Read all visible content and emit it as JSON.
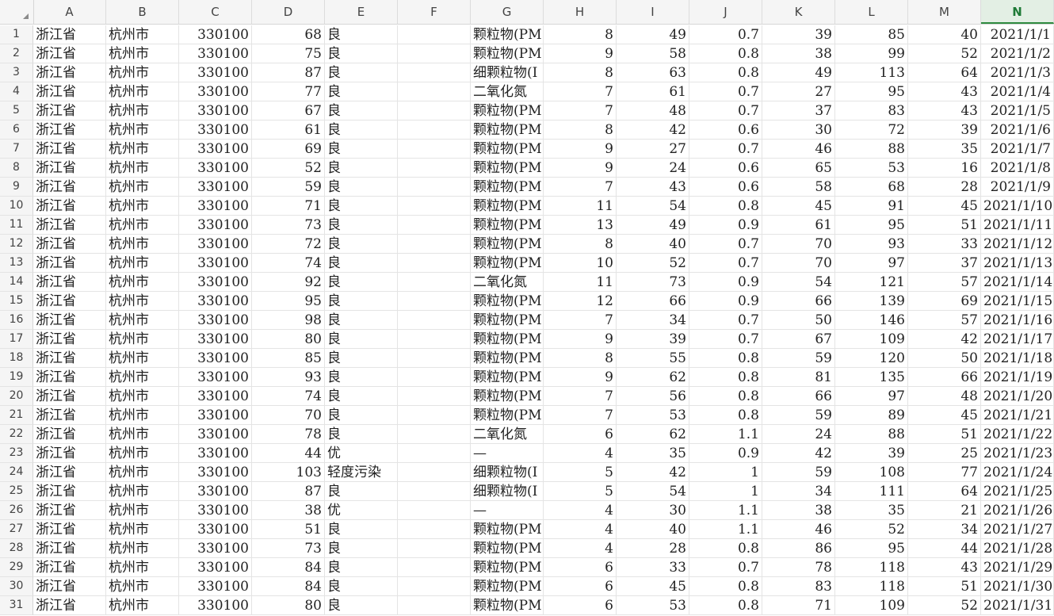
{
  "columns": [
    "A",
    "B",
    "C",
    "D",
    "E",
    "F",
    "G",
    "H",
    "I",
    "J",
    "K",
    "L",
    "M",
    "N"
  ],
  "active_column": "N",
  "rows": [
    [
      "1",
      "浙江省",
      "杭州市",
      "330100",
      "68",
      "良",
      "",
      "颗粒物(PM",
      "8",
      "49",
      "0.7",
      "39",
      "85",
      "40",
      "2021/1/1"
    ],
    [
      "2",
      "浙江省",
      "杭州市",
      "330100",
      "75",
      "良",
      "",
      "颗粒物(PM",
      "9",
      "58",
      "0.8",
      "38",
      "99",
      "52",
      "2021/1/2"
    ],
    [
      "3",
      "浙江省",
      "杭州市",
      "330100",
      "87",
      "良",
      "",
      "细颗粒物(I",
      "8",
      "63",
      "0.8",
      "49",
      "113",
      "64",
      "2021/1/3"
    ],
    [
      "4",
      "浙江省",
      "杭州市",
      "330100",
      "77",
      "良",
      "",
      "二氧化氮",
      "7",
      "61",
      "0.7",
      "27",
      "95",
      "43",
      "2021/1/4"
    ],
    [
      "5",
      "浙江省",
      "杭州市",
      "330100",
      "67",
      "良",
      "",
      "颗粒物(PM",
      "7",
      "48",
      "0.7",
      "37",
      "83",
      "43",
      "2021/1/5"
    ],
    [
      "6",
      "浙江省",
      "杭州市",
      "330100",
      "61",
      "良",
      "",
      "颗粒物(PM",
      "8",
      "42",
      "0.6",
      "30",
      "72",
      "39",
      "2021/1/6"
    ],
    [
      "7",
      "浙江省",
      "杭州市",
      "330100",
      "69",
      "良",
      "",
      "颗粒物(PM",
      "9",
      "27",
      "0.7",
      "46",
      "88",
      "35",
      "2021/1/7"
    ],
    [
      "8",
      "浙江省",
      "杭州市",
      "330100",
      "52",
      "良",
      "",
      "颗粒物(PM",
      "9",
      "24",
      "0.6",
      "65",
      "53",
      "16",
      "2021/1/8"
    ],
    [
      "9",
      "浙江省",
      "杭州市",
      "330100",
      "59",
      "良",
      "",
      "颗粒物(PM",
      "7",
      "43",
      "0.6",
      "58",
      "68",
      "28",
      "2021/1/9"
    ],
    [
      "10",
      "浙江省",
      "杭州市",
      "330100",
      "71",
      "良",
      "",
      "颗粒物(PM",
      "11",
      "54",
      "0.8",
      "45",
      "91",
      "45",
      "2021/1/10"
    ],
    [
      "11",
      "浙江省",
      "杭州市",
      "330100",
      "73",
      "良",
      "",
      "颗粒物(PM",
      "13",
      "49",
      "0.9",
      "61",
      "95",
      "51",
      "2021/1/11"
    ],
    [
      "12",
      "浙江省",
      "杭州市",
      "330100",
      "72",
      "良",
      "",
      "颗粒物(PM",
      "8",
      "40",
      "0.7",
      "70",
      "93",
      "33",
      "2021/1/12"
    ],
    [
      "13",
      "浙江省",
      "杭州市",
      "330100",
      "74",
      "良",
      "",
      "颗粒物(PM",
      "10",
      "52",
      "0.7",
      "70",
      "97",
      "37",
      "2021/1/13"
    ],
    [
      "14",
      "浙江省",
      "杭州市",
      "330100",
      "92",
      "良",
      "",
      "二氧化氮",
      "11",
      "73",
      "0.9",
      "54",
      "121",
      "57",
      "2021/1/14"
    ],
    [
      "15",
      "浙江省",
      "杭州市",
      "330100",
      "95",
      "良",
      "",
      "颗粒物(PM",
      "12",
      "66",
      "0.9",
      "66",
      "139",
      "69",
      "2021/1/15"
    ],
    [
      "16",
      "浙江省",
      "杭州市",
      "330100",
      "98",
      "良",
      "",
      "颗粒物(PM",
      "7",
      "34",
      "0.7",
      "50",
      "146",
      "57",
      "2021/1/16"
    ],
    [
      "17",
      "浙江省",
      "杭州市",
      "330100",
      "80",
      "良",
      "",
      "颗粒物(PM",
      "9",
      "39",
      "0.7",
      "67",
      "109",
      "42",
      "2021/1/17"
    ],
    [
      "18",
      "浙江省",
      "杭州市",
      "330100",
      "85",
      "良",
      "",
      "颗粒物(PM",
      "8",
      "55",
      "0.8",
      "59",
      "120",
      "50",
      "2021/1/18"
    ],
    [
      "19",
      "浙江省",
      "杭州市",
      "330100",
      "93",
      "良",
      "",
      "颗粒物(PM",
      "9",
      "62",
      "0.8",
      "81",
      "135",
      "66",
      "2021/1/19"
    ],
    [
      "20",
      "浙江省",
      "杭州市",
      "330100",
      "74",
      "良",
      "",
      "颗粒物(PM",
      "7",
      "56",
      "0.8",
      "66",
      "97",
      "48",
      "2021/1/20"
    ],
    [
      "21",
      "浙江省",
      "杭州市",
      "330100",
      "70",
      "良",
      "",
      "颗粒物(PM",
      "7",
      "53",
      "0.8",
      "59",
      "89",
      "45",
      "2021/1/21"
    ],
    [
      "22",
      "浙江省",
      "杭州市",
      "330100",
      "78",
      "良",
      "",
      "二氧化氮",
      "6",
      "62",
      "1.1",
      "24",
      "88",
      "51",
      "2021/1/22"
    ],
    [
      "23",
      "浙江省",
      "杭州市",
      "330100",
      "44",
      "优",
      "",
      "—",
      "4",
      "35",
      "0.9",
      "42",
      "39",
      "25",
      "2021/1/23"
    ],
    [
      "24",
      "浙江省",
      "杭州市",
      "330100",
      "103",
      "轻度污染",
      "",
      "细颗粒物(I",
      "5",
      "42",
      "1",
      "59",
      "108",
      "77",
      "2021/1/24"
    ],
    [
      "25",
      "浙江省",
      "杭州市",
      "330100",
      "87",
      "良",
      "",
      "细颗粒物(I",
      "5",
      "54",
      "1",
      "34",
      "111",
      "64",
      "2021/1/25"
    ],
    [
      "26",
      "浙江省",
      "杭州市",
      "330100",
      "38",
      "优",
      "",
      "—",
      "4",
      "30",
      "1.1",
      "38",
      "35",
      "21",
      "2021/1/26"
    ],
    [
      "27",
      "浙江省",
      "杭州市",
      "330100",
      "51",
      "良",
      "",
      "颗粒物(PM",
      "4",
      "40",
      "1.1",
      "46",
      "52",
      "34",
      "2021/1/27"
    ],
    [
      "28",
      "浙江省",
      "杭州市",
      "330100",
      "73",
      "良",
      "",
      "颗粒物(PM",
      "4",
      "28",
      "0.8",
      "86",
      "95",
      "44",
      "2021/1/28"
    ],
    [
      "29",
      "浙江省",
      "杭州市",
      "330100",
      "84",
      "良",
      "",
      "颗粒物(PM",
      "6",
      "33",
      "0.7",
      "78",
      "118",
      "43",
      "2021/1/29"
    ],
    [
      "30",
      "浙江省",
      "杭州市",
      "330100",
      "84",
      "良",
      "",
      "颗粒物(PM",
      "6",
      "45",
      "0.8",
      "83",
      "118",
      "51",
      "2021/1/30"
    ],
    [
      "31",
      "浙江省",
      "杭州市",
      "330100",
      "80",
      "良",
      "",
      "颗粒物(PM",
      "6",
      "53",
      "0.8",
      "71",
      "109",
      "52",
      "2021/1/31"
    ]
  ]
}
